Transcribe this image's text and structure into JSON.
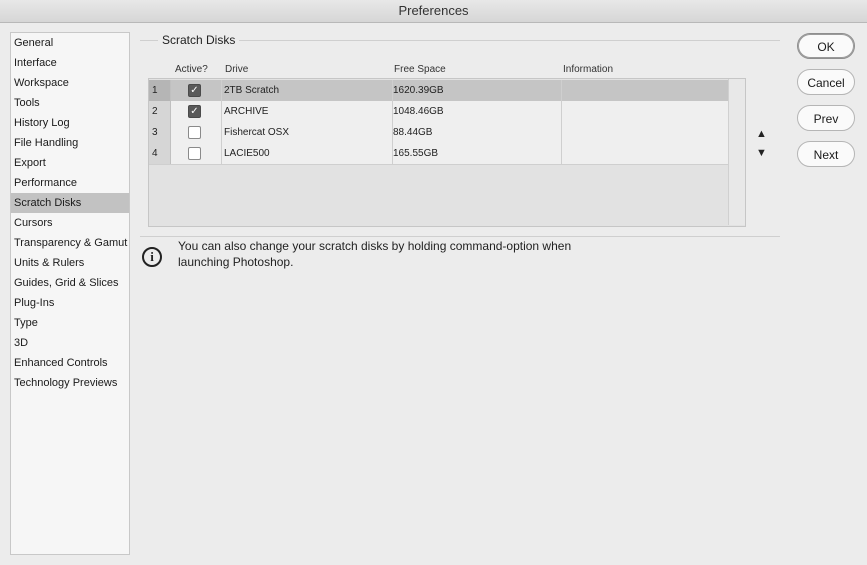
{
  "window": {
    "title": "Preferences"
  },
  "sidebar": {
    "items": [
      {
        "label": "General"
      },
      {
        "label": "Interface"
      },
      {
        "label": "Workspace"
      },
      {
        "label": "Tools"
      },
      {
        "label": "History Log"
      },
      {
        "label": "File Handling"
      },
      {
        "label": "Export"
      },
      {
        "label": "Performance"
      },
      {
        "label": "Scratch Disks",
        "selected": true
      },
      {
        "label": "Cursors"
      },
      {
        "label": "Transparency & Gamut"
      },
      {
        "label": "Units & Rulers"
      },
      {
        "label": "Guides, Grid & Slices"
      },
      {
        "label": "Plug-Ins"
      },
      {
        "label": "Type"
      },
      {
        "label": "3D"
      },
      {
        "label": "Enhanced Controls"
      },
      {
        "label": "Technology Previews"
      }
    ]
  },
  "scratch_disks": {
    "group_title": "Scratch Disks",
    "columns": {
      "active": "Active?",
      "drive": "Drive",
      "free_space": "Free Space",
      "information": "Information"
    },
    "rows": [
      {
        "num": "1",
        "active": true,
        "drive": "2TB Scratch",
        "free_space": "1620.39GB",
        "information": "",
        "selected": true
      },
      {
        "num": "2",
        "active": true,
        "drive": "ARCHIVE",
        "free_space": "1048.46GB",
        "information": ""
      },
      {
        "num": "3",
        "active": false,
        "drive": "Fishercat OSX",
        "free_space": "88.44GB",
        "information": ""
      },
      {
        "num": "4",
        "active": false,
        "drive": "LACIE500",
        "free_space": "165.55GB",
        "information": ""
      }
    ],
    "move_up_icon": "triangle-up",
    "move_down_icon": "triangle-down",
    "info_text": "You can also change your scratch disks by holding command-option when launching Photoshop.",
    "info_icon": "info-circle"
  },
  "buttons": {
    "ok": "OK",
    "cancel": "Cancel",
    "prev": "Prev",
    "next": "Next"
  }
}
